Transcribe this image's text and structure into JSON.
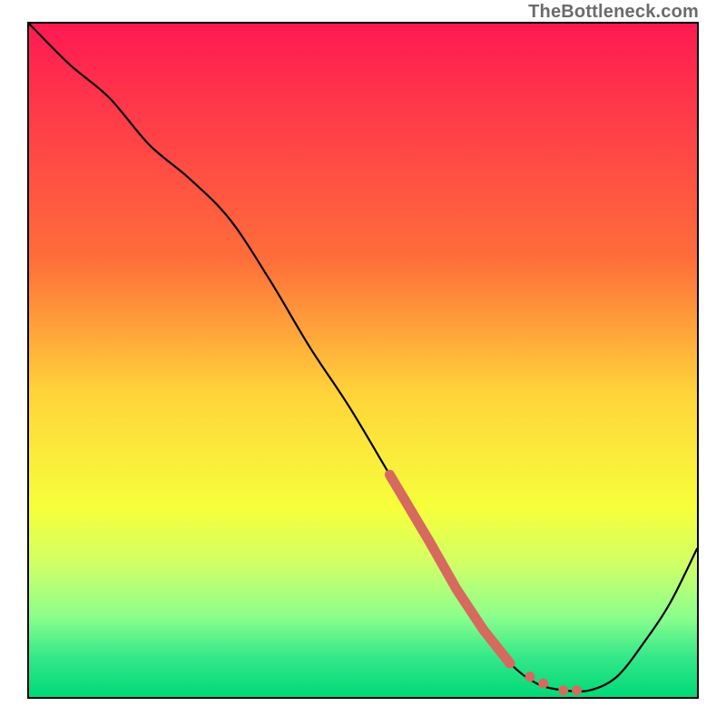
{
  "watermark": "TheBottleneck.com",
  "chart_data": {
    "type": "line",
    "title": "",
    "xlabel": "",
    "ylabel": "",
    "xlim": [
      0,
      100
    ],
    "ylim": [
      0,
      100
    ],
    "gradient_stops": [
      {
        "offset": 0,
        "color": "#ff1a52"
      },
      {
        "offset": 0.35,
        "color": "#ff6e3a"
      },
      {
        "offset": 0.55,
        "color": "#ffd43a"
      },
      {
        "offset": 0.72,
        "color": "#f6ff3a"
      },
      {
        "offset": 0.8,
        "color": "#d2ff66"
      },
      {
        "offset": 0.88,
        "color": "#8cff8c"
      },
      {
        "offset": 0.94,
        "color": "#35e88a"
      },
      {
        "offset": 1.0,
        "color": "#00d977"
      }
    ],
    "series": [
      {
        "name": "bottleneck-curve",
        "x": [
          0,
          6,
          12,
          18,
          24,
          30,
          36,
          42,
          48,
          54,
          60,
          64,
          68,
          72,
          76,
          80,
          84,
          88,
          92,
          96,
          100
        ],
        "y": [
          100,
          94,
          89,
          82,
          77,
          71,
          62,
          52,
          43,
          33,
          23,
          16,
          10,
          5,
          2,
          1,
          1,
          3,
          8,
          14,
          22
        ]
      }
    ],
    "highlight_segment": {
      "name": "highlight",
      "color": "#d66a5e",
      "x": [
        54,
        60,
        64,
        68,
        72
      ],
      "y": [
        33,
        23,
        16,
        10,
        5
      ]
    },
    "highlight_dots": {
      "name": "dots",
      "color": "#d66a5e",
      "points": [
        {
          "x": 72,
          "y": 5
        },
        {
          "x": 75,
          "y": 3
        },
        {
          "x": 77,
          "y": 2
        },
        {
          "x": 80,
          "y": 1
        },
        {
          "x": 82,
          "y": 1
        }
      ]
    }
  }
}
